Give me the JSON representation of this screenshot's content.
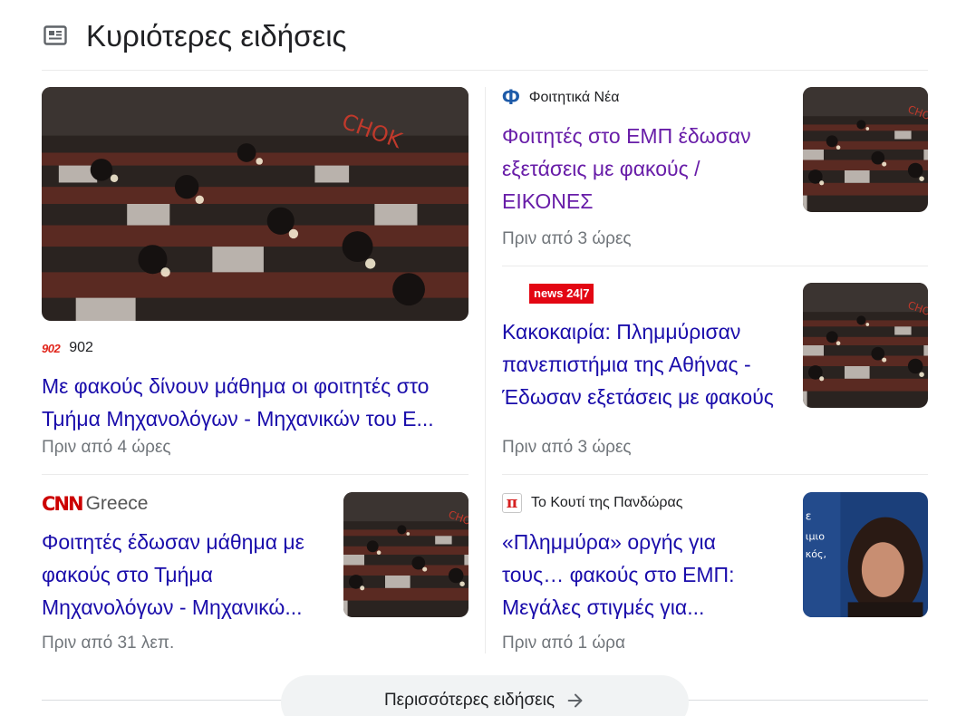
{
  "section": {
    "title": "Κυριότερες ειδήσεις",
    "icon": "newspaper-icon"
  },
  "stories": [
    {
      "source": "902",
      "source_logo": "902",
      "headline": "Με φακούς δίνουν μάθημα οι φοιτητές στο Τμήμα Μηχανολόγων - Μηχανικών του Ε...",
      "time": "Πριν από 4 ώρες"
    },
    {
      "source": "Φοιτητικά Νέα",
      "source_logo": "Φ",
      "headline": "Φοιτητές στο ΕΜΠ έδωσαν εξετάσεις με φακούς / ΕΙΚΟΝΕΣ",
      "time": "Πριν από 3 ώρες",
      "visited": true
    },
    {
      "source": "",
      "source_logo": "news 24|7",
      "headline": "Κακοκαιρία: Πλημμύρισαν πανεπιστήμια της Αθήνας - Έδωσαν εξετάσεις με φακούς",
      "time": "Πριν από 3 ώρες"
    },
    {
      "source": "Greece",
      "source_logo": "CNN",
      "headline": "Φοιτητές έδωσαν μάθημα με φακούς στο Τμήμα Μηχανολόγων - Μηχανικώ...",
      "time": "Πριν από 31 λεπ."
    },
    {
      "source": "Το Κουτί της Πανδώρας",
      "source_logo": "π",
      "headline": "«Πλημμύρα» οργής για τους… φακούς στο ΕΜΠ: Μεγάλες στιγμές για...",
      "time": "Πριν από 1 ώρα"
    }
  ],
  "more_news": {
    "label": "Περισσότερες ειδήσεις",
    "icon": "arrow-right-icon"
  },
  "colors": {
    "headline": "#1a0dab",
    "headline_visited": "#681da8",
    "meta": "#70757a",
    "divider": "#ebebeb",
    "button_bg": "#f1f3f4"
  }
}
